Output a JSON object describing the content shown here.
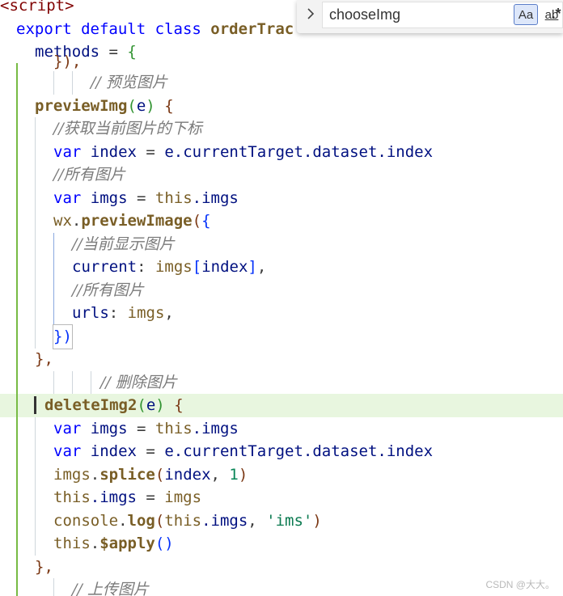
{
  "find": {
    "query": "chooseImg",
    "match_case_label": "Aa",
    "whole_word_label": "ab",
    "regex_label": ".*"
  },
  "code": {
    "l0_tag": "<script>",
    "l1_export": "export",
    "l1_default": "default",
    "l1_class": "class",
    "l1_name": "orderTrac",
    "l2_methods": "methods",
    "l2_eq": " = ",
    "l2_brace": "{",
    "l3_partial": "}),",
    "l4_comment": "// 预览图片",
    "l5_fn": "previewImg",
    "l5_param": "e",
    "l6_comment": "//获取当前图片的下标",
    "l7_var": "var",
    "l7_name": "index",
    "l7_rhs_e": "e",
    "l7_rhs_rest": ".currentTarget.dataset.index",
    "l8_comment": "//所有图片",
    "l9_var": "var",
    "l9_name": "imgs",
    "l9_this": "this",
    "l9_prop": ".imgs",
    "l10_obj": "wx",
    "l10_fn": "previewImage",
    "l11_comment": "//当前显示图片",
    "l12_key": "current",
    "l12_val": "imgs",
    "l12_idx": "index",
    "l13_comment": "//所有图片",
    "l14_key": "urls",
    "l14_val": "imgs",
    "l15_close": "})",
    "l16_close": "},",
    "l17_comment": "// 删除图片",
    "l18_fn": "deleteImg2",
    "l18_param": "e",
    "l19_var": "var",
    "l19_name": "imgs",
    "l19_this": "this",
    "l19_prop": ".imgs",
    "l20_var": "var",
    "l20_name": "index",
    "l20_rhs_e": "e",
    "l20_rhs_rest": ".currentTarget.dataset.index",
    "l21_obj": "imgs",
    "l21_fn": "splice",
    "l21_arg1": "index",
    "l21_arg2": "1",
    "l22_this": "this",
    "l22_prop": ".imgs",
    "l22_val": "imgs",
    "l23_obj": "console",
    "l23_fn": "log",
    "l23_this": "this",
    "l23_prop": ".imgs",
    "l23_str": "'ims'",
    "l24_this": "this",
    "l24_fn": "$apply",
    "l25_close": "},",
    "l26_comment": "// 上传图片"
  },
  "watermark": "CSDN @大大。",
  "colors": {
    "keyword": "#0000ff",
    "function": "#795e26",
    "variable": "#001080",
    "comment": "#7a7a7a",
    "string": "#a31515",
    "number": "#098658",
    "current_line": "#e8f6df",
    "active_guide": "#78bb45"
  }
}
